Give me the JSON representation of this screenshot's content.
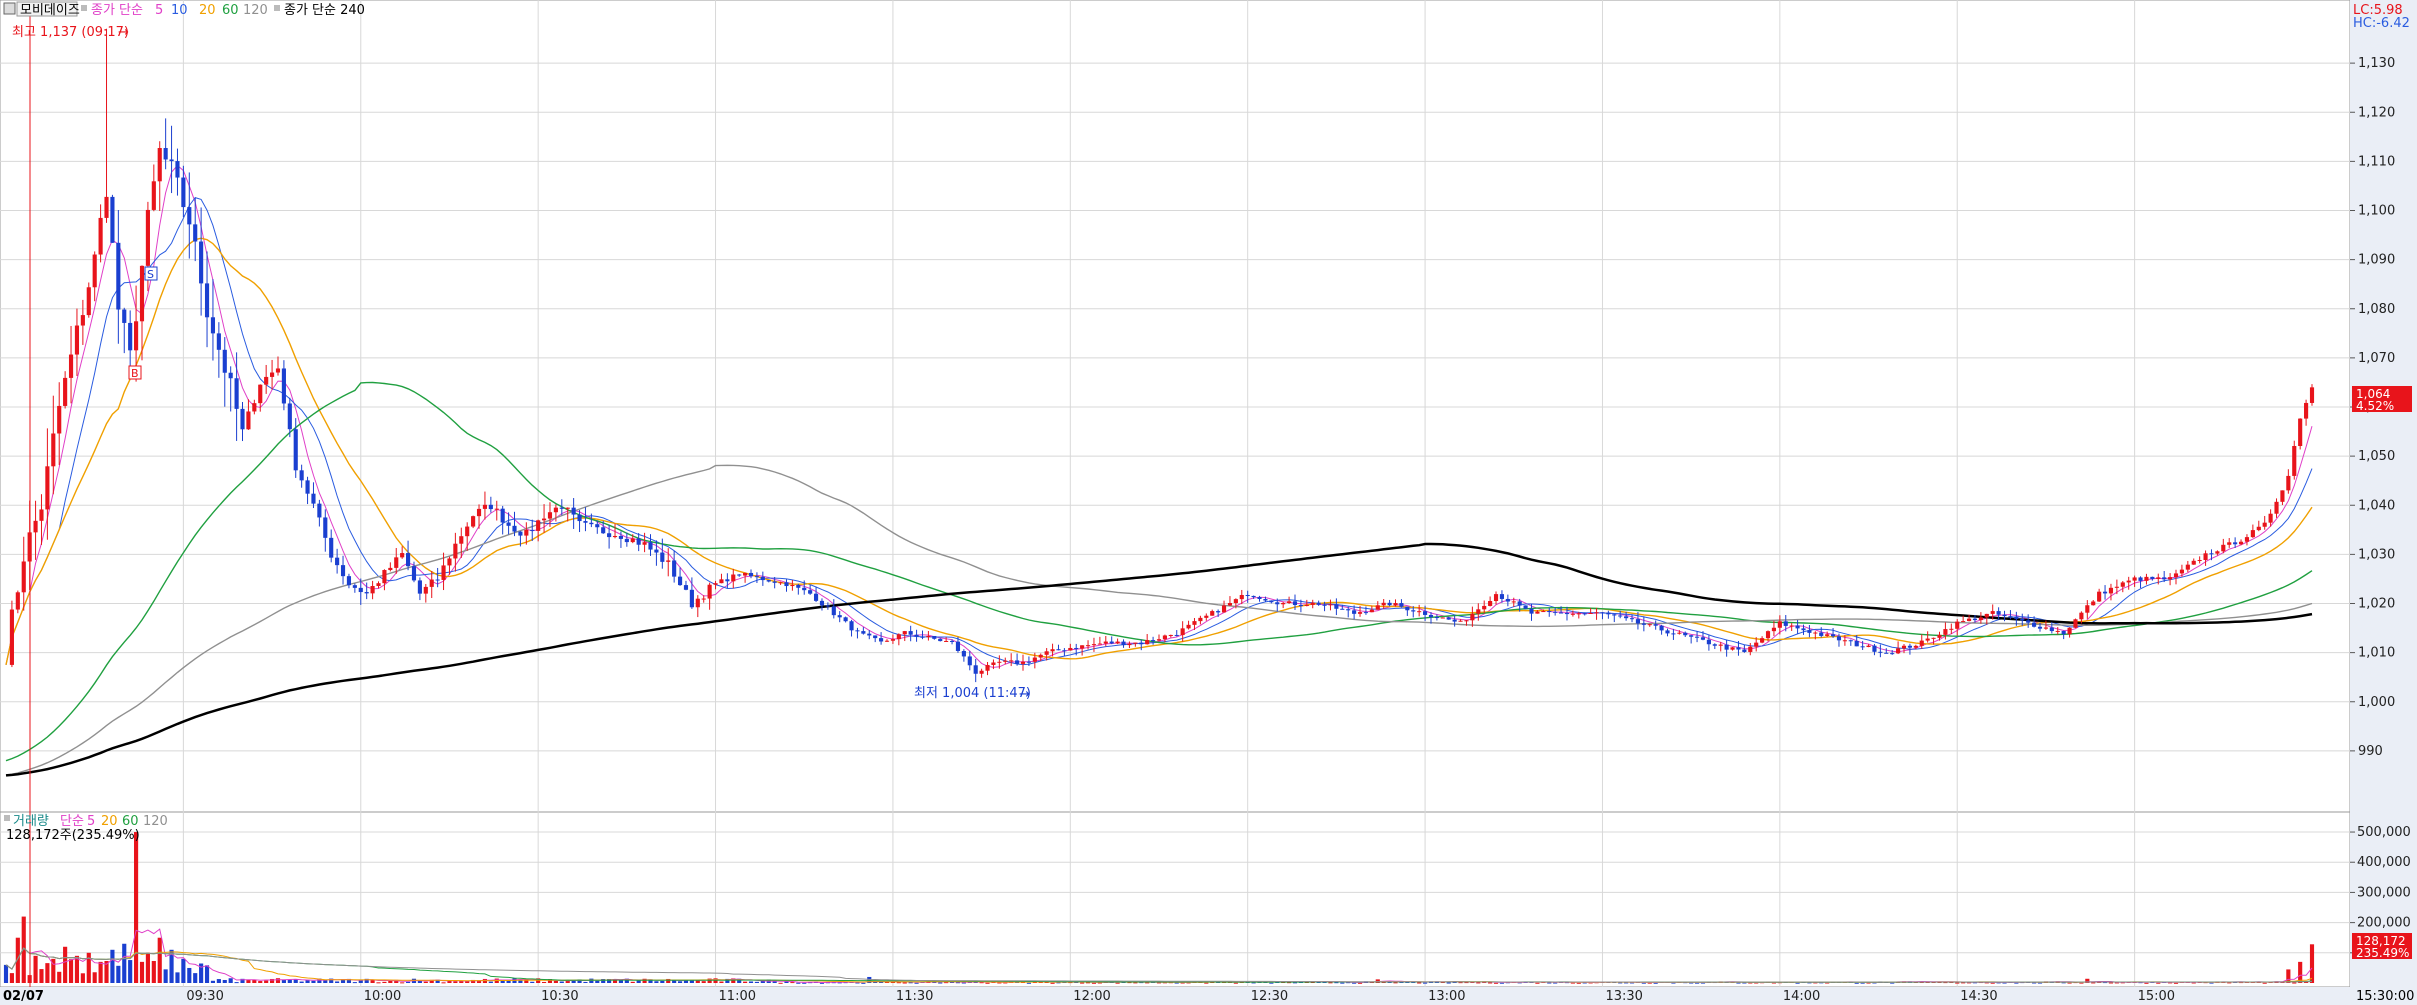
{
  "header": {
    "stock_name": "모비데이즈",
    "ma_title": "종가 단순",
    "ma_periods": [
      "5",
      "10",
      "20",
      "60",
      "120"
    ],
    "long_ma_label": "종가 단순 240",
    "lc": "LC:5.98",
    "hc": "HC:-6.42"
  },
  "annotations": {
    "high": "최고 1,137 (09:17)",
    "low": "최저 1,004 (11:47)",
    "signal_b": "B",
    "signal_s": "S"
  },
  "price_tag": {
    "value": "1,064",
    "pct": "4.52%"
  },
  "volume_panel": {
    "title": "거래량",
    "ma_title": "단순",
    "ma_periods": [
      "5",
      "20",
      "60",
      "120"
    ],
    "value_text": "128,172주(235.49%)",
    "tag_value": "128,172",
    "tag_pct": "235.49%"
  },
  "x_axis": {
    "date": "02/07",
    "last_time": "15:30:00"
  },
  "colors": {
    "up": "#e8141b",
    "down": "#1a3fd0",
    "ma5": "#e040c8",
    "ma10": "#2a5ce0",
    "ma20": "#f0a000",
    "ma60": "#20a040",
    "ma120": "#909090",
    "ma240": "#000000",
    "grid": "#d8d8d8",
    "axis_bg": "#eaeef6"
  },
  "chart_data": {
    "type": "candlestick",
    "price_ticks": [
      990,
      1000,
      1010,
      1020,
      1030,
      1040,
      1050,
      1060,
      1070,
      1080,
      1090,
      1100,
      1110,
      1120,
      1130
    ],
    "price_tick_labels": [
      "990",
      "1,000",
      "1,010",
      "1,020",
      "1,030",
      "1,040",
      "1,050",
      "1,060",
      "1,070",
      "1,080",
      "1,090",
      "1,100",
      "1,110",
      "1,120",
      "1,130"
    ],
    "ylim": [
      980,
      1140
    ],
    "time_labels": [
      "09:30",
      "10:00",
      "10:30",
      "11:00",
      "11:30",
      "12:00",
      "12:30",
      "13:00",
      "13:30",
      "14:00",
      "14:30",
      "15:00"
    ],
    "time_ticks_min": [
      30,
      60,
      90,
      120,
      150,
      180,
      210,
      240,
      270,
      300,
      330,
      360
    ],
    "session_minutes": 390,
    "high": 1137,
    "high_time": "09:17",
    "low": 1004,
    "low_time": "11:47",
    "last_close": 1064,
    "price_keypoints": [
      [
        0,
        1010
      ],
      [
        3,
        1030
      ],
      [
        6,
        1040
      ],
      [
        9,
        1060
      ],
      [
        12,
        1075
      ],
      [
        15,
        1090
      ],
      [
        17,
        1105
      ],
      [
        19,
        1080
      ],
      [
        21,
        1070
      ],
      [
        24,
        1098
      ],
      [
        26,
        1112
      ],
      [
        28,
        1108
      ],
      [
        31,
        1098
      ],
      [
        34,
        1080
      ],
      [
        37,
        1068
      ],
      [
        40,
        1055
      ],
      [
        43,
        1065
      ],
      [
        46,
        1068
      ],
      [
        49,
        1048
      ],
      [
        52,
        1040
      ],
      [
        55,
        1030
      ],
      [
        58,
        1024
      ],
      [
        61,
        1022
      ],
      [
        64,
        1026
      ],
      [
        67,
        1030
      ],
      [
        70,
        1022
      ],
      [
        73,
        1025
      ],
      [
        76,
        1032
      ],
      [
        79,
        1038
      ],
      [
        82,
        1040
      ],
      [
        85,
        1036
      ],
      [
        88,
        1034
      ],
      [
        91,
        1038
      ],
      [
        94,
        1040
      ],
      [
        97,
        1036
      ],
      [
        100,
        1035
      ],
      [
        104,
        1034
      ],
      [
        108,
        1032
      ],
      [
        112,
        1028
      ],
      [
        116,
        1020
      ],
      [
        120,
        1024
      ],
      [
        124,
        1026
      ],
      [
        128,
        1025
      ],
      [
        132,
        1024
      ],
      [
        136,
        1022
      ],
      [
        140,
        1018
      ],
      [
        144,
        1014
      ],
      [
        148,
        1012
      ],
      [
        152,
        1014
      ],
      [
        156,
        1013
      ],
      [
        160,
        1012
      ],
      [
        164,
        1006
      ],
      [
        168,
        1008
      ],
      [
        172,
        1008
      ],
      [
        176,
        1010
      ],
      [
        180,
        1011
      ],
      [
        186,
        1012
      ],
      [
        192,
        1012
      ],
      [
        198,
        1014
      ],
      [
        204,
        1018
      ],
      [
        210,
        1022
      ],
      [
        216,
        1020
      ],
      [
        222,
        1020
      ],
      [
        228,
        1018
      ],
      [
        234,
        1020
      ],
      [
        240,
        1018
      ],
      [
        246,
        1016
      ],
      [
        252,
        1022
      ],
      [
        258,
        1018
      ],
      [
        264,
        1018
      ],
      [
        270,
        1018
      ],
      [
        276,
        1016
      ],
      [
        282,
        1014
      ],
      [
        288,
        1012
      ],
      [
        294,
        1010
      ],
      [
        300,
        1016
      ],
      [
        306,
        1014
      ],
      [
        312,
        1012
      ],
      [
        318,
        1010
      ],
      [
        324,
        1012
      ],
      [
        330,
        1016
      ],
      [
        336,
        1018
      ],
      [
        342,
        1016
      ],
      [
        348,
        1014
      ],
      [
        354,
        1022
      ],
      [
        360,
        1025
      ],
      [
        366,
        1025
      ],
      [
        372,
        1030
      ],
      [
        378,
        1033
      ],
      [
        382,
        1036
      ],
      [
        386,
        1046
      ],
      [
        388,
        1058
      ],
      [
        390,
        1064
      ]
    ],
    "volume_ticks": [
      100000,
      200000,
      300000,
      400000,
      500000
    ],
    "volume_tick_labels": [
      "100,000",
      "200,000",
      "300,000",
      "400,000",
      "500,000"
    ],
    "volume_ylim": [
      0,
      520000
    ],
    "last_volume": 128172,
    "volume_spikes": [
      [
        0,
        60000
      ],
      [
        2,
        150000
      ],
      [
        3,
        220000
      ],
      [
        5,
        90000
      ],
      [
        8,
        80000
      ],
      [
        10,
        120000
      ],
      [
        12,
        90000
      ],
      [
        14,
        100000
      ],
      [
        16,
        70000
      ],
      [
        18,
        110000
      ],
      [
        20,
        130000
      ],
      [
        22,
        500000
      ],
      [
        24,
        100000
      ],
      [
        26,
        150000
      ],
      [
        28,
        110000
      ],
      [
        30,
        80000
      ],
      [
        146,
        20000
      ],
      [
        232,
        12000
      ],
      [
        352,
        14000
      ],
      [
        386,
        45000
      ],
      [
        388,
        70000
      ],
      [
        390,
        128172
      ]
    ],
    "moving_averages": [
      {
        "name": "5",
        "period": 5,
        "color": "#e040c8"
      },
      {
        "name": "10",
        "period": 10,
        "color": "#2a5ce0"
      },
      {
        "name": "20",
        "period": 20,
        "color": "#f0a000"
      },
      {
        "name": "60",
        "period": 60,
        "color": "#20a040"
      },
      {
        "name": "120",
        "period": 120,
        "color": "#909090"
      },
      {
        "name": "240",
        "period": 240,
        "color": "#000000"
      }
    ]
  }
}
